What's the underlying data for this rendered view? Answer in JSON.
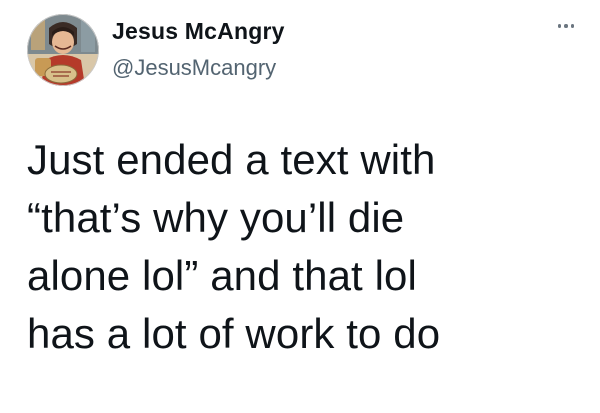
{
  "author": {
    "display_name": "Jesus McAngry",
    "handle": "@JesusMcangry",
    "avatar_icon": "cartoon-character-avatar-icon"
  },
  "menu": {
    "icon": "more-options-icon"
  },
  "tweet": {
    "lines": [
      "Just ended a text with",
      "“that’s why you’ll die",
      "alone lol” and that lol",
      "has a lot of work to do"
    ]
  },
  "colors": {
    "text_primary": "#0f1419",
    "text_secondary": "#536471"
  }
}
